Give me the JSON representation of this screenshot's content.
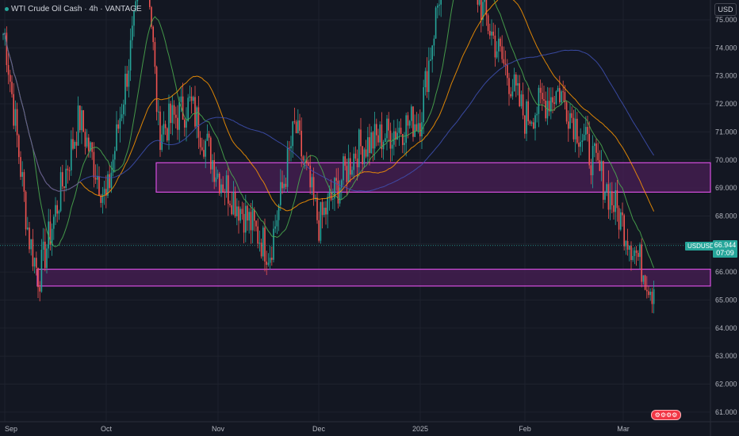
{
  "header": {
    "title": "WTI Crude Oil Cash · 4h · VANTAGE",
    "currency": "USD"
  },
  "last_price": {
    "symbol": "USDUSD",
    "value": "66.944",
    "countdown": "07:09"
  },
  "nav": {
    "pill_label": "⚙⚙⚙⚙"
  },
  "colors": {
    "background": "#131722",
    "up": "#26a69a",
    "down": "#ef5350",
    "zone_fill": "#4a1f55",
    "zone_border": "#d64fe0",
    "grid": "#1e222d",
    "axis_text": "#b2b5be"
  },
  "chart_data": {
    "type": "candlestick",
    "title": "WTI Crude Oil Cash · 4h · VANTAGE",
    "y_axis": {
      "ticks": [
        "75.000",
        "74.000",
        "73.000",
        "72.000",
        "71.000",
        "70.000",
        "69.000",
        "68.000",
        "67.000",
        "66.000",
        "65.000",
        "64.000",
        "63.000",
        "62.000",
        "61.000"
      ],
      "range": [
        60.5,
        75.5
      ],
      "position": "right"
    },
    "x_axis": {
      "ticks": [
        "Sep",
        "Oct",
        "Nov",
        "Dec",
        "2025",
        "Feb",
        "Mar"
      ]
    },
    "price_path": [
      {
        "t": "Sep",
        "close": 74.5
      },
      {
        "t": "Sep (mid)",
        "close": 67.3
      },
      {
        "t": "Sep (low)",
        "close": 65.8
      },
      {
        "t": "Sep (late)",
        "close": 71.5
      },
      {
        "t": "Oct",
        "close": 68.5
      },
      {
        "t": "Oct (high)",
        "close": 77.5
      },
      {
        "t": "Oct (mid)",
        "close": 71.0
      },
      {
        "t": "Oct (late)",
        "close": 72.0
      },
      {
        "t": "Nov",
        "close": 69.5
      },
      {
        "t": "Nov (low)",
        "close": 66.7
      },
      {
        "t": "Nov (mid)",
        "close": 71.2
      },
      {
        "t": "Dec",
        "close": 67.7
      },
      {
        "t": "Dec (mid)",
        "close": 70.4
      },
      {
        "t": "2025",
        "close": 71.5
      },
      {
        "t": "2025 (high)",
        "close": 78.5
      },
      {
        "t": "Jan (late)",
        "close": 74.5
      },
      {
        "t": "Feb",
        "close": 71.5
      },
      {
        "t": "Feb (mid)",
        "close": 72.5
      },
      {
        "t": "Feb (late)",
        "close": 69.3
      },
      {
        "t": "Mar",
        "close": 65.3
      },
      {
        "t": "Mar (last)",
        "close": 66.944
      }
    ],
    "zones": [
      {
        "name": "upper demand zone",
        "from": "Oct",
        "to": "Mar",
        "high": 69.9,
        "low": 68.85
      },
      {
        "name": "lower demand zone",
        "from": "Sep",
        "to": "Mar",
        "high": 66.1,
        "low": 65.5
      }
    ],
    "moving_averages": [
      "ma-fast",
      "ma-slow",
      "ma-long"
    ],
    "last_price": 66.944
  }
}
